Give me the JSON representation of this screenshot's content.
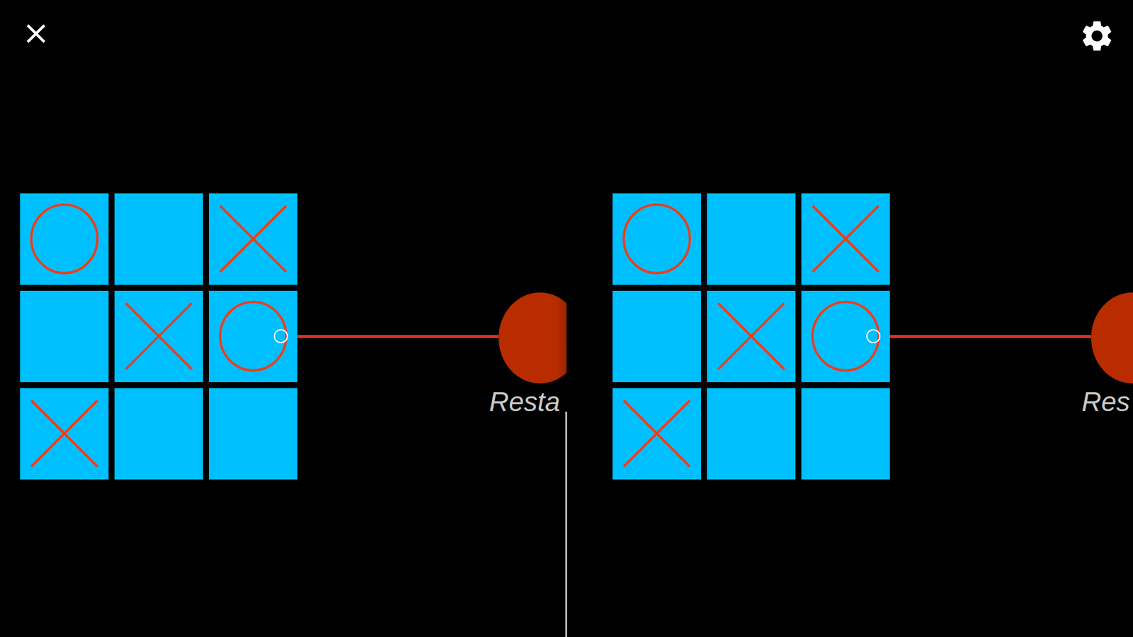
{
  "toolbar": {
    "close": true,
    "settings": true
  },
  "board": {
    "cells": [
      {
        "mark": "O",
        "hovered": false
      },
      {
        "mark": "",
        "hovered": false
      },
      {
        "mark": "X",
        "hovered": false
      },
      {
        "mark": "",
        "hovered": false
      },
      {
        "mark": "X",
        "hovered": false
      },
      {
        "mark": "O",
        "hovered": true
      },
      {
        "mark": "X",
        "hovered": false
      },
      {
        "mark": "",
        "hovered": false
      },
      {
        "mark": "",
        "hovered": false
      }
    ]
  },
  "eyes": [
    {
      "view": "left",
      "restart_label": "Resta"
    },
    {
      "view": "right",
      "restart_label": "Res"
    }
  ]
}
